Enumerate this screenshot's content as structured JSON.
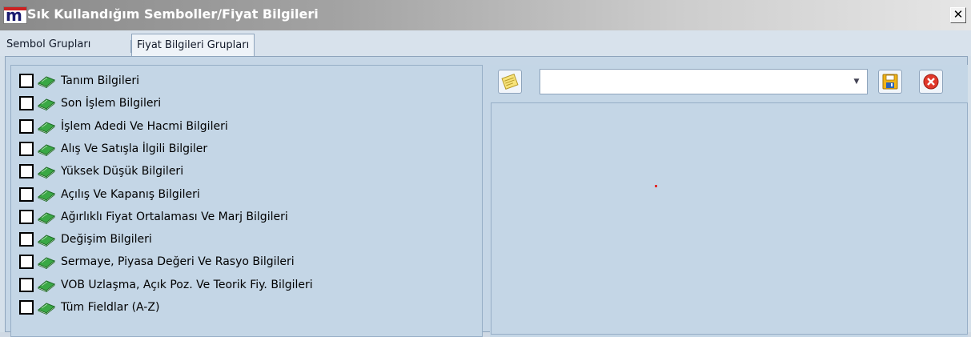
{
  "window": {
    "title": "Sık Kullandığım Semboller/Fiyat Bilgileri",
    "close_label": "✕"
  },
  "tabs": [
    {
      "label": "Sembol Grupları",
      "active": false
    },
    {
      "label": "Fiyat Bilgileri Grupları",
      "active": true
    }
  ],
  "tree": {
    "items": [
      {
        "label": "Tanım Bilgileri",
        "checked": false,
        "icon": "green-book-icon"
      },
      {
        "label": "Son İşlem Bilgileri",
        "checked": false,
        "icon": "green-book-icon"
      },
      {
        "label": "İşlem Adedi Ve Hacmi Bilgileri",
        "checked": false,
        "icon": "green-book-icon"
      },
      {
        "label": "Alış Ve Satışla İlgili Bilgiler",
        "checked": false,
        "icon": "green-book-icon"
      },
      {
        "label": "Yüksek Düşük Bilgileri",
        "checked": false,
        "icon": "green-book-icon"
      },
      {
        "label": "Açılış Ve Kapanış Bilgileri",
        "checked": false,
        "icon": "green-book-icon"
      },
      {
        "label": "Ağırlıklı Fiyat Ortalaması Ve Marj Bilgileri",
        "checked": false,
        "icon": "green-book-icon"
      },
      {
        "label": "Değişim Bilgileri",
        "checked": false,
        "icon": "green-book-icon"
      },
      {
        "label": "Sermaye, Piyasa Değeri Ve Rasyo Bilgileri",
        "checked": false,
        "icon": "green-book-icon"
      },
      {
        "label": "VOB Uzlaşma, Açık Poz. Ve Teorik Fiy. Bilgileri",
        "checked": false,
        "icon": "green-book-icon"
      },
      {
        "label": "Tüm Fieldlar (A-Z)",
        "checked": false,
        "icon": "green-book-icon"
      }
    ]
  },
  "toolbar": {
    "notes_icon": "notes-icon",
    "combo_value": "",
    "save_icon": "save-icon",
    "delete_icon": "delete-icon"
  },
  "colors": {
    "accent_red": "#e23030",
    "book_green": "#2e9a3a"
  }
}
